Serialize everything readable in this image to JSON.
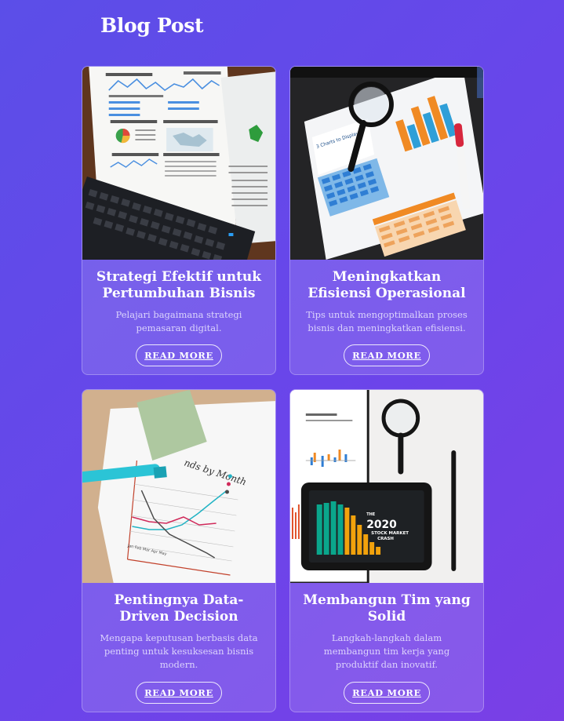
{
  "page": {
    "title": "Blog Post"
  },
  "colors": {
    "background_start": "#5b4ee8",
    "background_end": "#7a3fe6",
    "card_text": "#ffffff"
  },
  "posts": [
    {
      "title": "Strategi Efektif untuk Pertumbuhan Bisnis",
      "description": "Pelajari bagaimana strategi pemasaran digital.",
      "button_label": "READ MORE",
      "image_name": "analytics-report-keyboard-photo"
    },
    {
      "title": "Meningkatkan Efisiensi Operasional",
      "description": "Tips untuk mengoptimalkan proses bisnis dan meningkatkan efisiensi.",
      "button_label": "READ MORE",
      "image_name": "magnifier-charts-photo"
    },
    {
      "title": "Pentingnya Data-Driven Decision",
      "description": "Mengapa keputusan berbasis data penting untuk kesuksesan bisnis modern.",
      "button_label": "READ MORE",
      "image_name": "hand-drawn-trend-chart-photo"
    },
    {
      "title": "Membangun Tim yang Solid",
      "description": "Langkah-langkah dalam membangun tim kerja yang produktif dan inovatif.",
      "button_label": "READ MORE",
      "image_name": "stock-market-crash-tablet-photo",
      "image_text": {
        "line1": "THE",
        "line2": "2020",
        "line3": "STOCK MARKET",
        "line4": "CRASH"
      }
    }
  ]
}
